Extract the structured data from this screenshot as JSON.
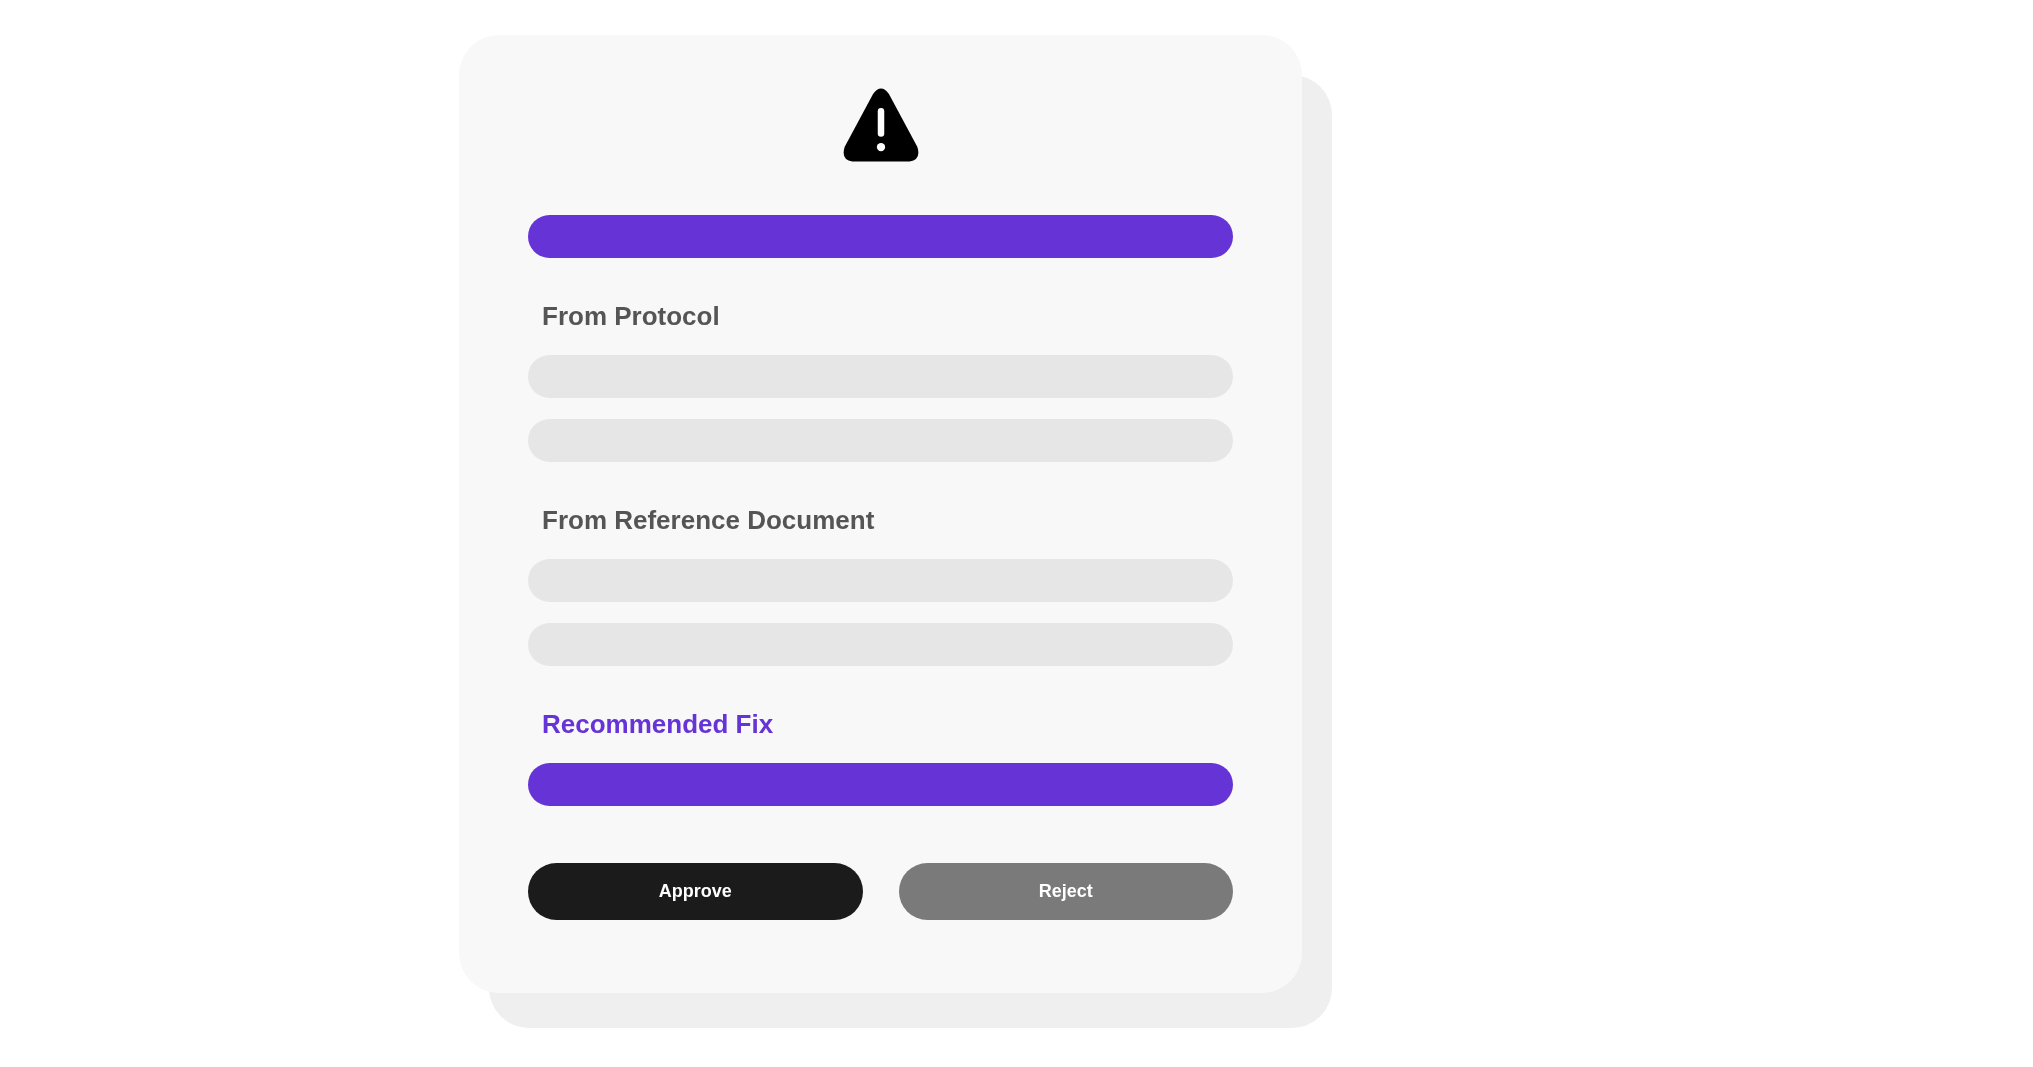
{
  "top_bar": {
    "kind": "accent"
  },
  "sections": [
    {
      "heading": "From Protocol",
      "kind": "neutral",
      "lines": [
        {
          "kind": "placeholder"
        },
        {
          "kind": "placeholder"
        }
      ]
    },
    {
      "heading": "From Reference Document",
      "kind": "neutral",
      "lines": [
        {
          "kind": "placeholder"
        },
        {
          "kind": "placeholder"
        }
      ]
    },
    {
      "heading": "Recommended Fix",
      "kind": "accent",
      "lines": [
        {
          "kind": "accent"
        }
      ]
    }
  ],
  "buttons": [
    {
      "label": "Approve",
      "kind": "primary"
    },
    {
      "label": "Reject",
      "kind": "secondary"
    }
  ]
}
